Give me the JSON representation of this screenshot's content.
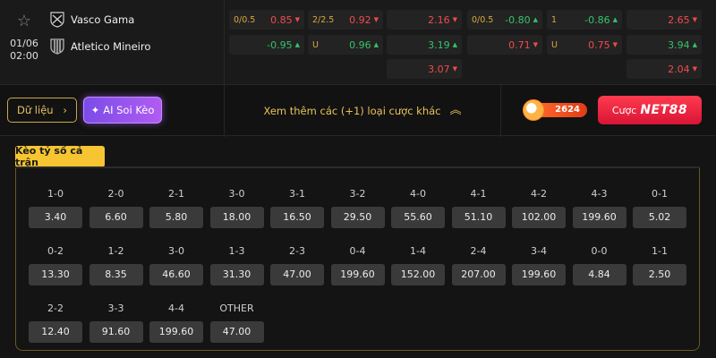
{
  "match": {
    "date": "01/06",
    "time": "02:00",
    "home": "Vasco Gama",
    "away": "Atletico Mineiro"
  },
  "odds": {
    "c1": {
      "r1_label": "0/0.5",
      "r1_val": "0.85",
      "r2_val": "-0.95"
    },
    "c2": {
      "r1_label": "2/2.5",
      "r1_val": "0.92",
      "r2_label": "U",
      "r2_val": "0.96"
    },
    "c3": {
      "r1_val": "2.16",
      "r2_val": "3.19",
      "r3_val": "3.07"
    },
    "c4": {
      "r1_label": "0/0.5",
      "r1_val": "-0.80",
      "r2_val": "0.71"
    },
    "c5": {
      "r1_label": "1",
      "r1_val": "-0.86",
      "r2_label": "U",
      "r2_val": "0.75"
    },
    "c6": {
      "r1_val": "2.65",
      "r2_val": "3.94",
      "r3_val": "2.04"
    }
  },
  "actions": {
    "data_label": "Dữ liệu",
    "ai_label": "AI Soi Kèo",
    "more_label": "Xem thêm các (+1) loại cược khác",
    "badge_number": "2624",
    "bet_prefix": "Cược",
    "bet_brand": "NET88"
  },
  "score_tab": "Kèo tỷ số cả trận",
  "scores": [
    {
      "label": "1-0",
      "value": "3.40"
    },
    {
      "label": "2-0",
      "value": "6.60"
    },
    {
      "label": "2-1",
      "value": "5.80"
    },
    {
      "label": "3-0",
      "value": "18.00"
    },
    {
      "label": "3-1",
      "value": "16.50"
    },
    {
      "label": "3-2",
      "value": "29.50"
    },
    {
      "label": "4-0",
      "value": "55.60"
    },
    {
      "label": "4-1",
      "value": "51.10"
    },
    {
      "label": "4-2",
      "value": "102.00"
    },
    {
      "label": "4-3",
      "value": "199.60"
    },
    {
      "label": "0-1",
      "value": "5.02"
    },
    {
      "label": "0-2",
      "value": "13.30"
    },
    {
      "label": "1-2",
      "value": "8.35"
    },
    {
      "label": "3-0",
      "value": "46.60"
    },
    {
      "label": "1-3",
      "value": "31.30"
    },
    {
      "label": "2-3",
      "value": "47.00"
    },
    {
      "label": "0-4",
      "value": "199.60"
    },
    {
      "label": "1-4",
      "value": "152.00"
    },
    {
      "label": "2-4",
      "value": "207.00"
    },
    {
      "label": "3-4",
      "value": "199.60"
    },
    {
      "label": "0-0",
      "value": "4.84"
    },
    {
      "label": "1-1",
      "value": "2.50"
    },
    {
      "label": "2-2",
      "value": "12.40"
    },
    {
      "label": "3-3",
      "value": "91.60"
    },
    {
      "label": "4-4",
      "value": "199.60"
    },
    {
      "label": "OTHER",
      "value": "47.00"
    }
  ],
  "colors": {
    "accent_gold": "#f6c531",
    "odds_up": "#35c26b",
    "odds_down": "#f04b4b",
    "ai_purple": "#7b4ce8",
    "net_red": "#d81436"
  }
}
